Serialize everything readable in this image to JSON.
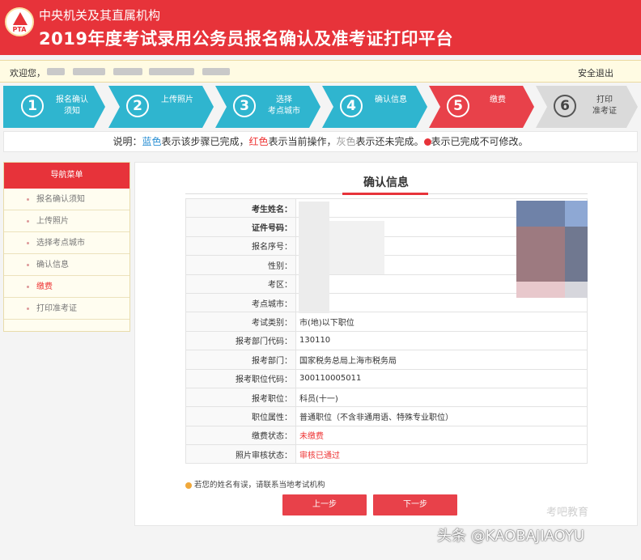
{
  "header": {
    "logo_text": "PTA",
    "subtitle": "中央机关及其直属机构",
    "title": "2019年度考试录用公务员报名确认及准考证打印平台"
  },
  "userbar": {
    "welcome": "欢迎您，",
    "logout": "安全退出"
  },
  "steps": [
    {
      "num": "1",
      "label": "报名确认\n须知",
      "state": "done"
    },
    {
      "num": "2",
      "label": "上传照片",
      "state": "done"
    },
    {
      "num": "3",
      "label": "选择\n考点城市",
      "state": "done"
    },
    {
      "num": "4",
      "label": "确认信息",
      "state": "done"
    },
    {
      "num": "5",
      "label": "缴费",
      "state": "current"
    },
    {
      "num": "6",
      "label": "打印\n准考证",
      "state": "todo"
    }
  ],
  "legend": {
    "p1": "说明：",
    "blue": "蓝色",
    "p2": "表示该步骤已完成，",
    "red": "红色",
    "p3": "表示当前操作，",
    "grey": "灰色",
    "p4": "表示还未完成。",
    "p5": "表示已完成不可修改。"
  },
  "sidebar": {
    "title": "导航菜单",
    "items": [
      {
        "label": "报名确认须知"
      },
      {
        "label": "上传照片"
      },
      {
        "label": "选择考点城市"
      },
      {
        "label": "确认信息"
      },
      {
        "label": "缴费"
      },
      {
        "label": "打印准考证"
      }
    ]
  },
  "main": {
    "title": "确认信息",
    "rows": [
      {
        "key": "考生姓名：",
        "value": ""
      },
      {
        "key": "证件号码：",
        "value": ""
      },
      {
        "key": "报名序号：",
        "value": ""
      },
      {
        "key": "性别：",
        "value": ""
      },
      {
        "key": "考区：",
        "value": ""
      },
      {
        "key": "考点城市：",
        "value": ""
      },
      {
        "key": "考试类别：",
        "value": "市(地)以下职位"
      },
      {
        "key": "报考部门代码：",
        "value": "130110"
      },
      {
        "key": "报考部门：",
        "value": "国家税务总局上海市税务局"
      },
      {
        "key": "报考职位代码：",
        "value": "300110005011"
      },
      {
        "key": "报考职位：",
        "value": "科员(十一)"
      },
      {
        "key": "职位属性：",
        "value": "普通职位（不含非通用语、特殊专业职位）"
      },
      {
        "key": "缴费状态：",
        "value": "未缴费"
      },
      {
        "key": "照片审核状态：",
        "value": "审核已通过"
      }
    ],
    "note": "若您的姓名有误，请联系当地考试机构",
    "prev_button": "上一步",
    "next_button": "下一步"
  },
  "watermark": {
    "small": "考吧教育",
    "large": "头条 @KAOBAJIAOYU"
  },
  "colors": {
    "brand_red": "#e7333a",
    "done_blue": "#2fb5cf",
    "todo_grey": "#dadada"
  }
}
